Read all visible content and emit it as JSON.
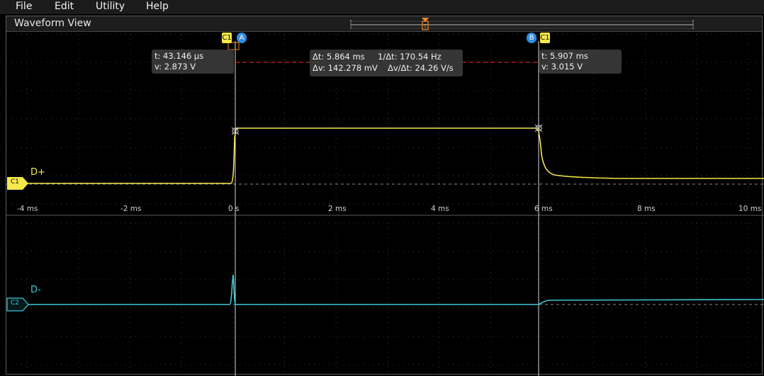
{
  "menu": {
    "file": "File",
    "edit": "Edit",
    "utility": "Utility",
    "help": "Help"
  },
  "view": {
    "title": "Waveform View"
  },
  "cursors": {
    "a": {
      "flag": "A",
      "source": "C1",
      "t": "t: 43.146 µs",
      "v": "v: 2.873 V"
    },
    "b": {
      "flag": "B",
      "source": "C1",
      "t": "t: 5.907 ms",
      "v": "v: 3.015 V"
    },
    "delta": {
      "dt": "Δt: 5.864 ms",
      "inv_dt": "1/Δt: 170.54 Hz",
      "dv": "Δv: 142.278 mV",
      "dv_dt": "Δv/Δt: 24.26 V/s"
    }
  },
  "channels": [
    {
      "badge": "C1",
      "name": "D+",
      "color": "#f5e84a"
    },
    {
      "badge": "C2",
      "name": "D-",
      "color": "#3ec9d6"
    }
  ],
  "time_axis": {
    "ticks": [
      "-4 ms",
      "-2 ms",
      "0 s",
      "2 ms",
      "4 ms",
      "6 ms",
      "8 ms",
      "10 ms"
    ]
  },
  "colors": {
    "cursor_line": "#d8d8d8",
    "delta_line": "#cc2222",
    "trigger": "#f08a24"
  }
}
